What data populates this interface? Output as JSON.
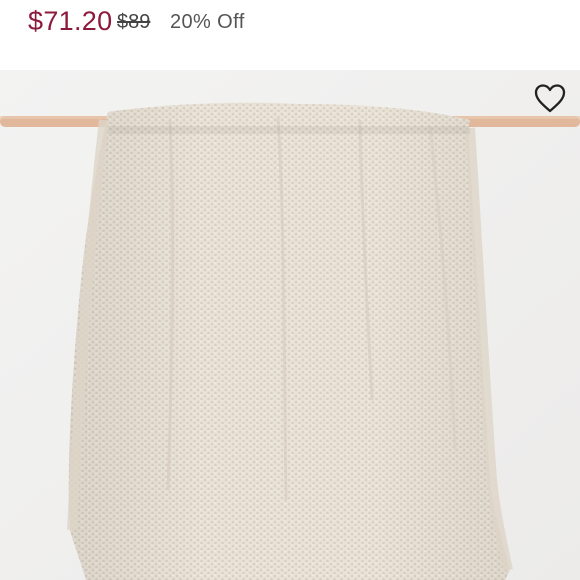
{
  "listing": {
    "price": "$71.20",
    "original_price": "$89",
    "discount": "20% Off"
  },
  "image": {
    "subject": "knit-throw-blanket-photo"
  },
  "actions": {
    "like_icon": "heart-outline-icon"
  },
  "colors": {
    "price": "#8c1a3c",
    "original_price": "#444444",
    "discount": "#555555",
    "photo_background": "#f2f2f1",
    "blanket": "#e9e2d6",
    "rod": "#e2b89d",
    "heart_stroke": "#222222"
  }
}
